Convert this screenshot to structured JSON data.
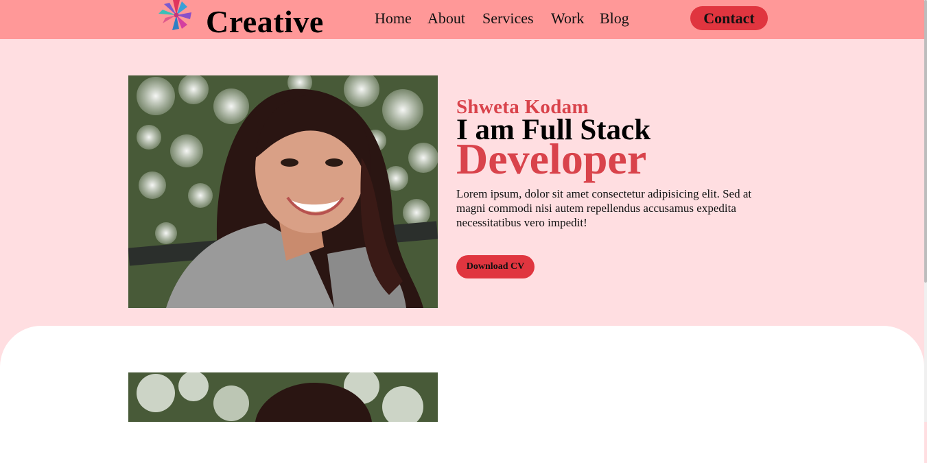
{
  "header": {
    "brand": "Creative",
    "nav": [
      "Home",
      "About",
      "Services",
      "Work",
      "Blog"
    ],
    "contact_label": "Contact"
  },
  "hero": {
    "name": "Shweta Kodam",
    "line1": "I am Full Stack",
    "line2": "Developer",
    "description": "Lorem ipsum, dolor sit amet consectetur adipisicing elit. Sed at magni commodi nisi autem repellendus accusamus expedita necessitatibus vero impedit!",
    "cta_label": "Download CV",
    "photo": "portrait-photo"
  },
  "icons": [
    "flower-logo-icon"
  ],
  "colors": {
    "header_bg": "#ff9898",
    "page_bg": "#ffdee1",
    "accent": "#d9434b",
    "button": "#e0353f"
  }
}
